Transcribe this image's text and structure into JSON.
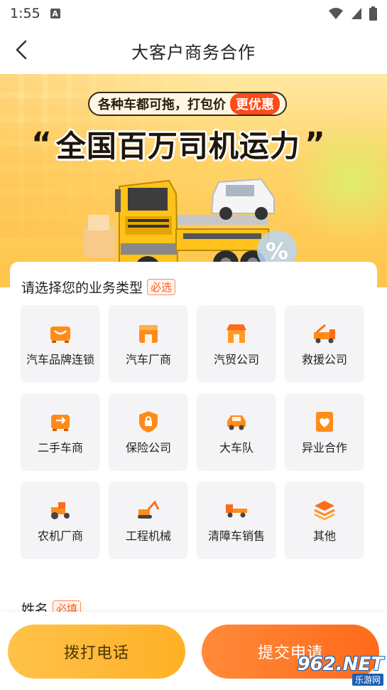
{
  "status_bar": {
    "time": "1:55",
    "notification_badge": "A"
  },
  "nav": {
    "title": "大客户商务合作"
  },
  "banner": {
    "promo_text": "各种车都可拖，打包价",
    "promo_badge": "更优惠",
    "headline": "全国百万司机运力",
    "quote_open": "“",
    "quote_close": "”"
  },
  "business_type": {
    "title": "请选择您的业务类型",
    "required_tag": "必选",
    "options": [
      {
        "label": "汽车品牌连锁",
        "icon": "car-chain-icon"
      },
      {
        "label": "汽车厂商",
        "icon": "factory-icon"
      },
      {
        "label": "汽贸公司",
        "icon": "shop-icon"
      },
      {
        "label": "救援公司",
        "icon": "rescue-truck-icon"
      },
      {
        "label": "二手车商",
        "icon": "used-car-icon"
      },
      {
        "label": "保险公司",
        "icon": "insurance-shield-icon"
      },
      {
        "label": "大车队",
        "icon": "fleet-car-icon"
      },
      {
        "label": "异业合作",
        "icon": "handshake-icon"
      },
      {
        "label": "农机厂商",
        "icon": "tractor-icon"
      },
      {
        "label": "工程机械",
        "icon": "excavator-icon"
      },
      {
        "label": "清障车销售",
        "icon": "tow-truck-icon"
      },
      {
        "label": "其他",
        "icon": "layers-icon"
      }
    ]
  },
  "name_field": {
    "label": "姓名",
    "required_tag": "必填"
  },
  "actions": {
    "call_label": "拨打电话",
    "submit_label": "提交申请"
  },
  "watermark": {
    "top": "962.NET",
    "bottom": "乐游网"
  },
  "colors": {
    "accent_orange": "#ff7a2a",
    "accent_yellow": "#ffb82e",
    "icon_orange": "#ff8c1a"
  }
}
